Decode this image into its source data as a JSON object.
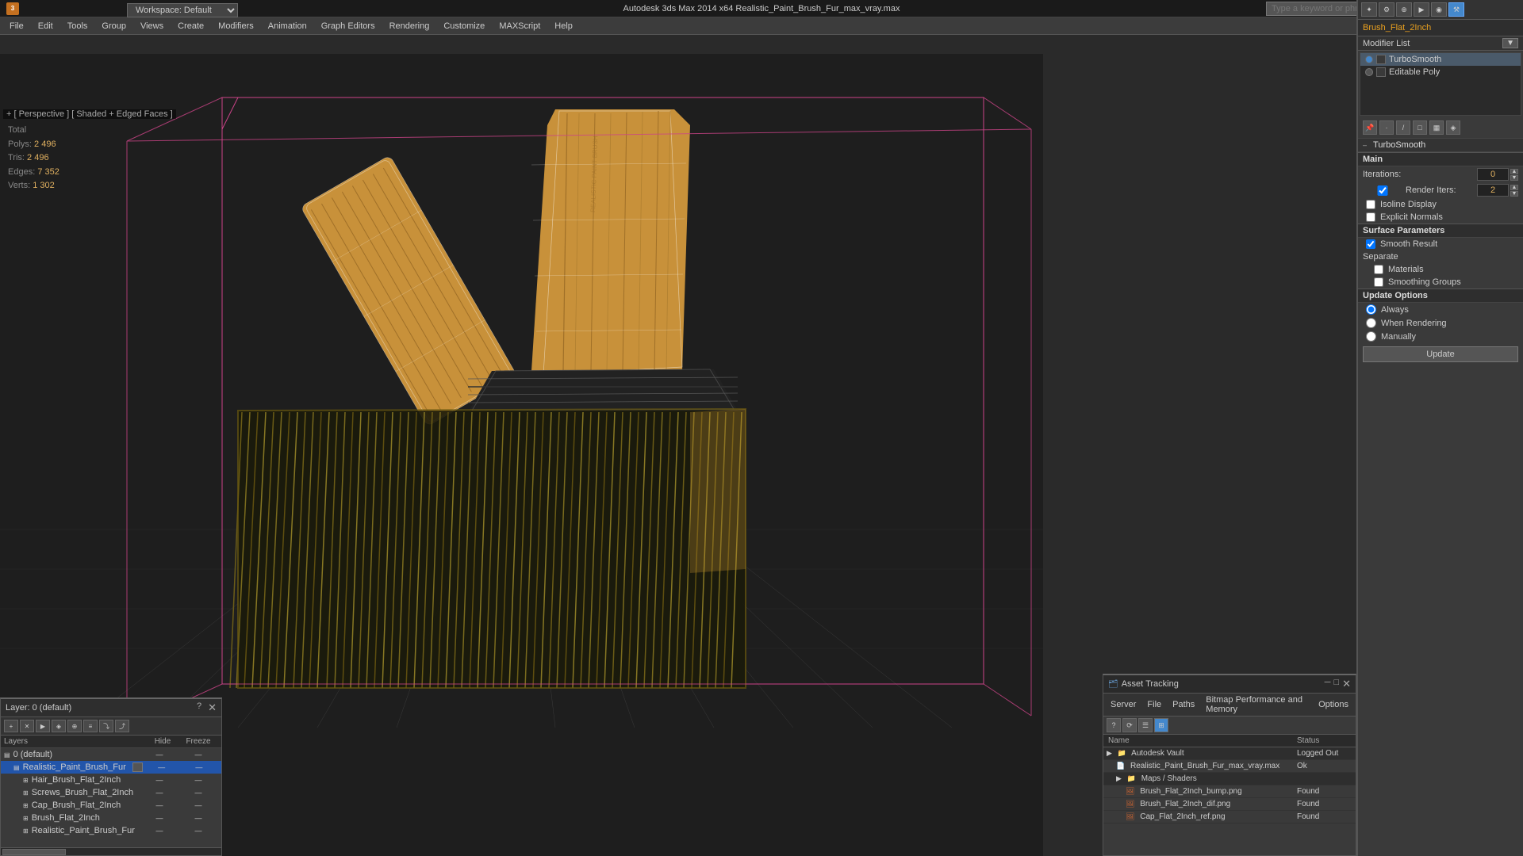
{
  "titlebar": {
    "app_icon": "3ds-max-icon",
    "workspace_label": "Workspace: Default",
    "title": "Autodesk 3ds Max 2014 x64     Realistic_Paint_Brush_Fur_max_vray.max",
    "search_placeholder": "Type a keyword or phrase",
    "close_label": "✕",
    "maximize_label": "□",
    "minimize_label": "─"
  },
  "menubar": {
    "items": [
      {
        "label": "File",
        "id": "file"
      },
      {
        "label": "Edit",
        "id": "edit"
      },
      {
        "label": "Tools",
        "id": "tools"
      },
      {
        "label": "Group",
        "id": "group"
      },
      {
        "label": "Views",
        "id": "views"
      },
      {
        "label": "Create",
        "id": "create"
      },
      {
        "label": "Modifiers",
        "id": "modifiers"
      },
      {
        "label": "Animation",
        "id": "animation"
      },
      {
        "label": "Graph Editors",
        "id": "graph-editors"
      },
      {
        "label": "Rendering",
        "id": "rendering"
      },
      {
        "label": "Customize",
        "id": "customize"
      },
      {
        "label": "MAXScript",
        "id": "maxscript"
      },
      {
        "label": "Help",
        "id": "help"
      }
    ]
  },
  "viewport": {
    "label": "+ [ Perspective ] [ Shaded + Edged Faces ]",
    "stats": {
      "polys_label": "Polys:",
      "polys_value": "2 496",
      "tris_label": "Tris:",
      "tris_value": "2 496",
      "edges_label": "Edges:",
      "edges_value": "7 352",
      "verts_label": "Verts:",
      "verts_value": "1 302",
      "total_label": "Total"
    }
  },
  "right_panel": {
    "object_name": "Brush_Flat_2Inch",
    "modifier_list_label": "Modifier List",
    "modifiers": [
      {
        "name": "TurboSmooth",
        "color": "blue",
        "visible": true
      },
      {
        "name": "Editable Poly",
        "color": "gray",
        "visible": true
      }
    ],
    "turbosmooth": {
      "title": "TurboSmooth",
      "main_section": "Main",
      "iterations_label": "Iterations:",
      "iterations_value": "0",
      "render_iters_label": "Render Iters:",
      "render_iters_value": "2",
      "render_iters_checked": true,
      "isoline_display_label": "Isoline Display",
      "isoline_display_checked": false,
      "explicit_normals_label": "Explicit Normals",
      "explicit_normals_checked": false,
      "surface_params_label": "Surface Parameters",
      "smooth_result_label": "Smooth Result",
      "smooth_result_checked": true,
      "separate_label": "Separate",
      "materials_label": "Materials",
      "materials_checked": false,
      "smoothing_groups_label": "Smoothing Groups",
      "smoothing_groups_checked": false,
      "update_options_label": "Update Options",
      "always_label": "Always",
      "always_checked": true,
      "when_rendering_label": "When Rendering",
      "when_rendering_checked": false,
      "manually_label": "Manually",
      "manually_checked": false,
      "update_btn_label": "Update"
    }
  },
  "layer_panel": {
    "title": "Layer: 0 (default)",
    "columns": {
      "name": "Layers",
      "hide": "Hide",
      "freeze": "Freeze"
    },
    "items": [
      {
        "name": "0 (default)",
        "indent": 0,
        "type": "layer"
      },
      {
        "name": "Realistic_Paint_Brush_Fur",
        "indent": 1,
        "type": "layer",
        "selected": true
      },
      {
        "name": "Hair_Brush_Flat_2Inch",
        "indent": 2,
        "type": "object"
      },
      {
        "name": "Screws_Brush_Flat_2Inch",
        "indent": 2,
        "type": "object"
      },
      {
        "name": "Cap_Brush_Flat_2Inch",
        "indent": 2,
        "type": "object"
      },
      {
        "name": "Brush_Flat_2Inch",
        "indent": 2,
        "type": "object"
      },
      {
        "name": "Realistic_Paint_Brush_Fur",
        "indent": 2,
        "type": "object"
      }
    ]
  },
  "asset_panel": {
    "title": "Asset Tracking",
    "menus": [
      "Server",
      "File",
      "Paths",
      "Bitmap Performance and Memory",
      "Options"
    ],
    "columns": {
      "name": "Name",
      "status": "Status"
    },
    "items": [
      {
        "name": "Autodesk Vault",
        "indent": 0,
        "status": "Logged Out",
        "type": "group",
        "status_class": "loggedout"
      },
      {
        "name": "Realistic_Paint_Brush_Fur_max_vray.max",
        "indent": 1,
        "status": "Ok",
        "type": "file",
        "status_class": "ok"
      },
      {
        "name": "Maps / Shaders",
        "indent": 1,
        "status": "",
        "type": "group"
      },
      {
        "name": "Brush_Flat_2Inch_bump.png",
        "indent": 2,
        "status": "Found",
        "type": "file",
        "status_class": "found"
      },
      {
        "name": "Brush_Flat_2Inch_dif.png",
        "indent": 2,
        "status": "Found",
        "type": "file",
        "status_class": "found"
      },
      {
        "name": "Cap_Flat_2Inch_ref.png",
        "indent": 2,
        "status": "Found",
        "type": "file",
        "status_class": "found"
      }
    ]
  }
}
